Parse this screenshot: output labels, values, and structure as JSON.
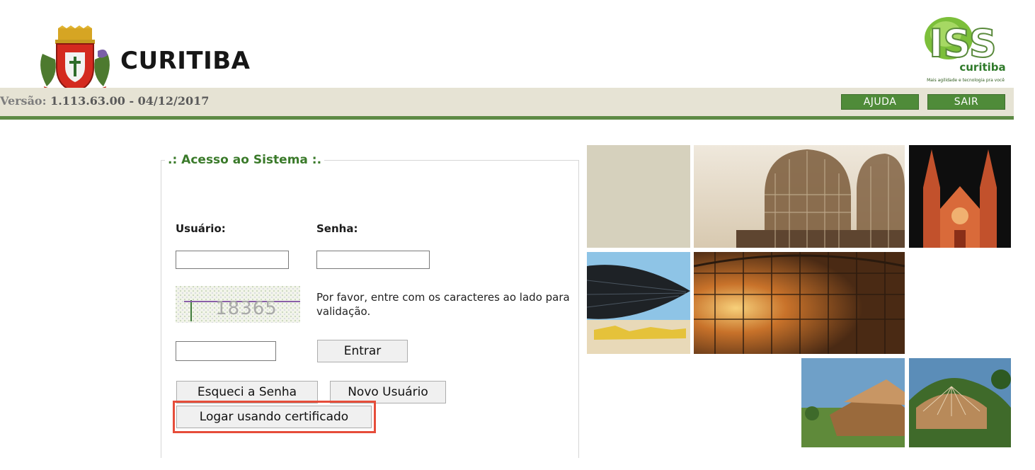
{
  "header": {
    "city_name": "CURITIBA",
    "version_label": "Versão:",
    "version_value": "1.113.63.00 - 04/12/2017",
    "iss_logo_text": "ISS",
    "iss_logo_sub": "curitiba",
    "iss_slogan": "Mais agilidade e tecnologia pra você",
    "buttons": {
      "help": "AJUDA",
      "exit": "SAIR"
    }
  },
  "login": {
    "legend": ".: Acesso ao Sistema :.",
    "user_label": "Usuário:",
    "password_label": "Senha:",
    "user_value": "",
    "password_value": "",
    "captcha_code": "18365",
    "captcha_instructions": "Por favor, entre com os caracteres ao lado para validação.",
    "captcha_value": "",
    "buttons": {
      "submit": "Entrar",
      "forgot_password": "Esqueci a Senha",
      "new_user": "Novo Usuário",
      "certificate_login": "Logar usando certificado"
    }
  },
  "colors": {
    "header_bar": "#e6e3d4",
    "accent_green": "#4f8b39",
    "legend_green": "#3a7a2a",
    "highlight_red": "#e64d3a"
  }
}
